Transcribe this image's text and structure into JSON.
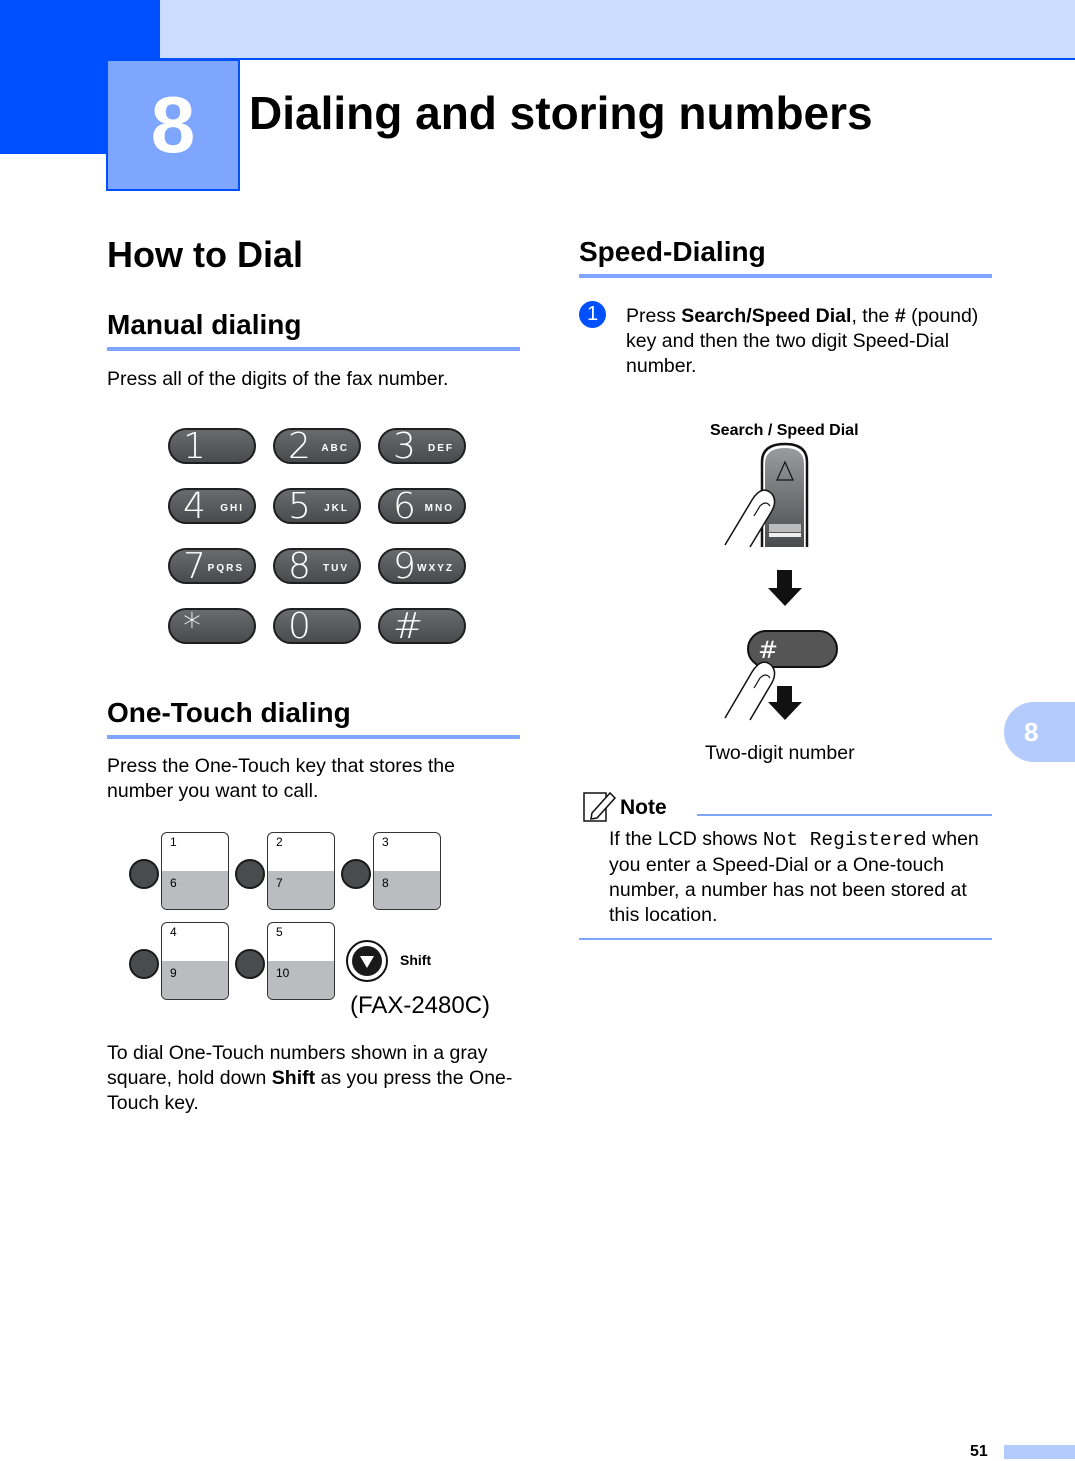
{
  "chapter": {
    "number": "8",
    "title": "Dialing and storing numbers"
  },
  "left": {
    "section_title": "How to Dial",
    "manual": {
      "heading": "Manual dialing",
      "text": "Press all of the digits of the fax number.",
      "keypad": [
        {
          "digit": "1",
          "letters": ""
        },
        {
          "digit": "2",
          "letters": "ABC"
        },
        {
          "digit": "3",
          "letters": "DEF"
        },
        {
          "digit": "4",
          "letters": "GHI"
        },
        {
          "digit": "5",
          "letters": "JKL"
        },
        {
          "digit": "6",
          "letters": "MNO"
        },
        {
          "digit": "7",
          "letters": "PQRS"
        },
        {
          "digit": "8",
          "letters": "TUV"
        },
        {
          "digit": "9",
          "letters": "WXYZ"
        },
        {
          "digit": "*",
          "letters": ""
        },
        {
          "digit": "0",
          "letters": ""
        },
        {
          "digit": "#",
          "letters": ""
        }
      ]
    },
    "onetouch": {
      "heading": "One-Touch dialing",
      "text": "Press the One-Touch key that stores the number you want to call.",
      "keys": [
        {
          "top": "1",
          "bottom": "6"
        },
        {
          "top": "2",
          "bottom": "7"
        },
        {
          "top": "3",
          "bottom": "8"
        },
        {
          "top": "4",
          "bottom": "9"
        },
        {
          "top": "5",
          "bottom": "10"
        }
      ],
      "shift_label": "Shift",
      "model": "(FAX-2480C)",
      "text2_a": "To dial One-Touch numbers shown in a gray square, hold down ",
      "text2_bold": "Shift",
      "text2_b": " as you press the One-Touch key."
    }
  },
  "right": {
    "heading": "Speed-Dialing",
    "step": {
      "number": "1",
      "a": "Press ",
      "b1": "Search/Speed Dial",
      "c": ", the ",
      "b2": "#",
      "d": " (pound) key and then the two digit Speed-Dial number."
    },
    "illustration": {
      "button_label": "Search / Speed Dial",
      "pound_key": "#",
      "caption": "Two-digit number"
    },
    "note": {
      "title": "Note",
      "a": "If the LCD shows ",
      "lcd": "Not Registered",
      "b": " when you enter a Speed-Dial or a One-touch number, a number has not been stored at this location."
    }
  },
  "side_tab": "8",
  "page_number": "51",
  "colors": {
    "primary": "#0050ff",
    "light": "#ccdcfc",
    "accent": "#7fa6ff",
    "tab": "#b3cbfd"
  }
}
